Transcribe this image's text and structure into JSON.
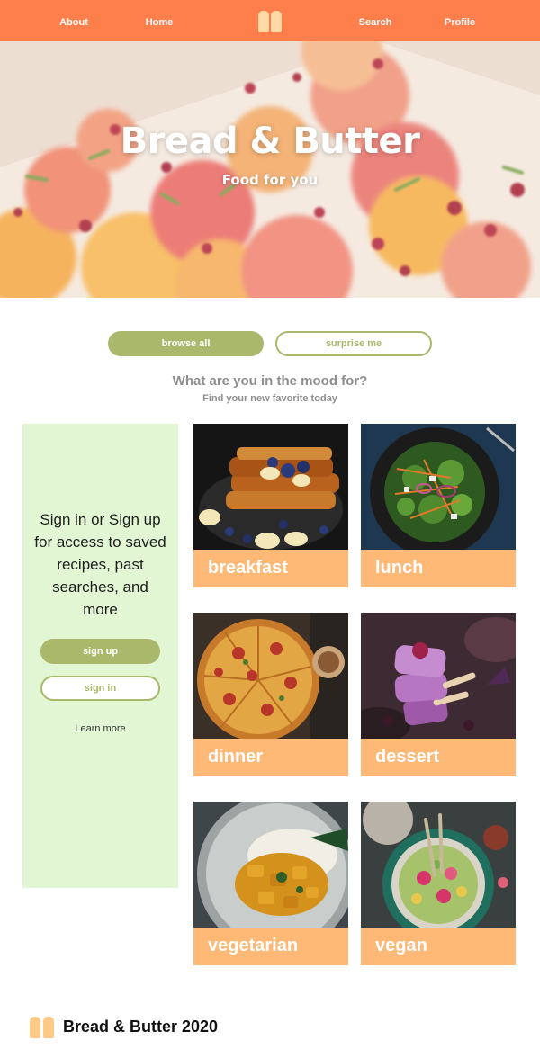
{
  "nav": {
    "about": "About",
    "home": "Home",
    "search": "Search",
    "profile": "Profile",
    "logo_icon": "bread-loaf-icon"
  },
  "hero": {
    "title": "Bread & Butter",
    "subtitle": "Food for you"
  },
  "actions": {
    "browse_all": "browse all",
    "surprise_me": "surprise me"
  },
  "prompt": {
    "heading": "What are you in the mood for?",
    "subheading": "Find your new favorite today"
  },
  "signin_panel": {
    "message": "Sign in or Sign up for access to saved recipes, past searches, and more",
    "sign_up": "sign up",
    "sign_in": "sign in",
    "learn_more": "Learn more"
  },
  "categories": [
    {
      "label": "breakfast"
    },
    {
      "label": "lunch"
    },
    {
      "label": "dinner"
    },
    {
      "label": "dessert"
    },
    {
      "label": "vegetarian"
    },
    {
      "label": "vegan"
    }
  ],
  "footer": {
    "text": "Bread & Butter 2020"
  },
  "colors": {
    "nav": "#ff7f4c",
    "accent_green": "#a9b86a",
    "card_label_bg": "#ffb977",
    "panel_bg": "#e2f6d4"
  }
}
